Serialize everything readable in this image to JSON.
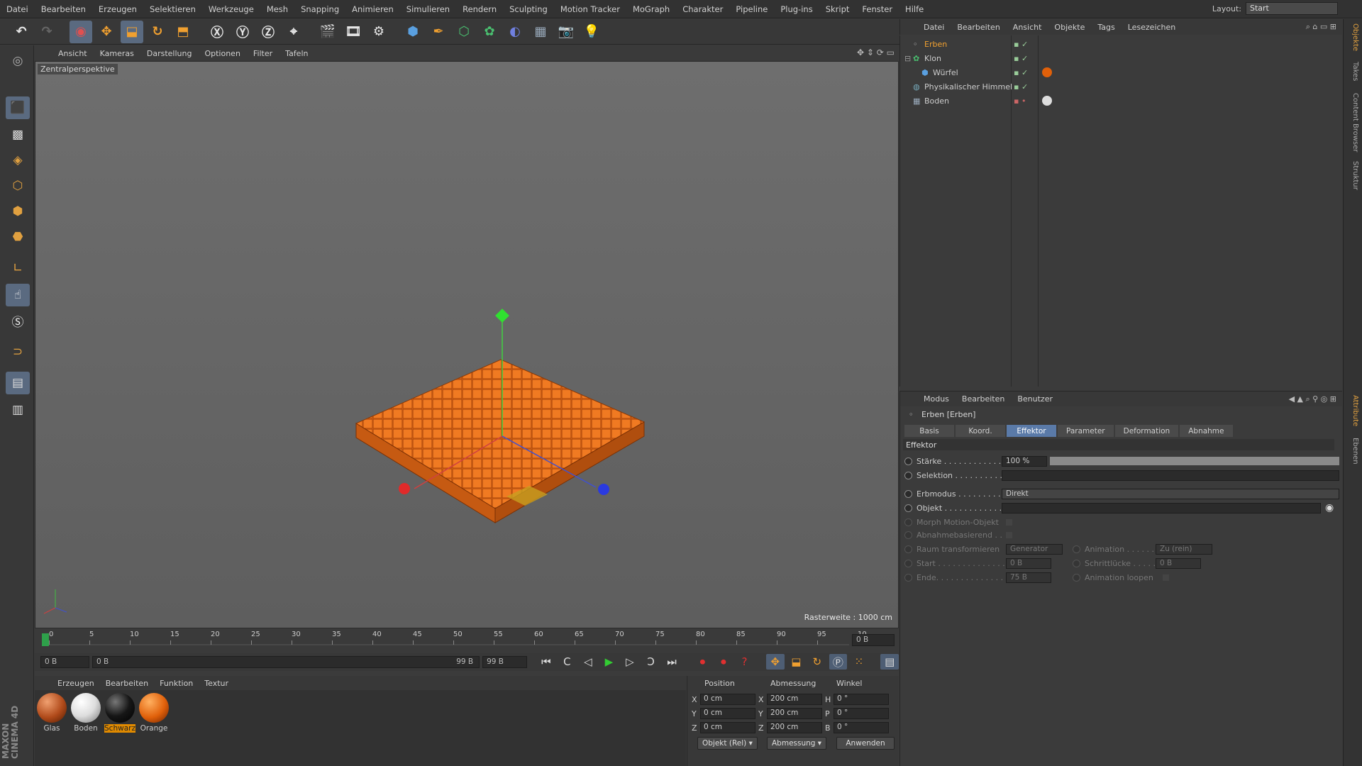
{
  "menubar": {
    "items": [
      "Datei",
      "Bearbeiten",
      "Erzeugen",
      "Selektieren",
      "Werkzeuge",
      "Mesh",
      "Snapping",
      "Animieren",
      "Simulieren",
      "Rendern",
      "Sculpting",
      "Motion Tracker",
      "MoGraph",
      "Charakter",
      "Pipeline",
      "Plug-ins",
      "Skript",
      "Fenster",
      "Hilfe"
    ],
    "layout_label": "Layout:",
    "layout_value": "Start"
  },
  "viewport": {
    "menu": [
      "Ansicht",
      "Kameras",
      "Darstellung",
      "Optionen",
      "Filter",
      "Tafeln"
    ],
    "label": "Zentralperspektive",
    "grid_label": "Rasterweite : 1000 cm"
  },
  "timeline": {
    "ticks": [
      "0",
      "5",
      "10",
      "15",
      "20",
      "25",
      "30",
      "35",
      "40",
      "45",
      "50",
      "55",
      "60",
      "65",
      "70",
      "75",
      "80",
      "85",
      "90",
      "95",
      "10"
    ],
    "end_field": "0 B",
    "start_frame": "0 B",
    "range_start": "0 B",
    "range_end": "99 B",
    "max_frame": "99 B"
  },
  "materials": {
    "menu": [
      "Erzeugen",
      "Bearbeiten",
      "Funktion",
      "Textur"
    ],
    "items": [
      {
        "name": "Glas",
        "color": "#b04a1a"
      },
      {
        "name": "Boden",
        "color": "#e8e8e8"
      },
      {
        "name": "Schwarz",
        "color": "#161616"
      },
      {
        "name": "Orange",
        "color": "#e0600a"
      }
    ]
  },
  "coords": {
    "headers": [
      "Position",
      "Abmessung",
      "Winkel"
    ],
    "rows": [
      {
        "axis": "X",
        "pos": "0 cm",
        "dim_axis": "X",
        "dim": "200 cm",
        "ang_axis": "H",
        "ang": "0 °"
      },
      {
        "axis": "Y",
        "pos": "0 cm",
        "dim_axis": "Y",
        "dim": "200 cm",
        "ang_axis": "P",
        "ang": "0 °"
      },
      {
        "axis": "Z",
        "pos": "0 cm",
        "dim_axis": "Z",
        "dim": "200 cm",
        "ang_axis": "B",
        "ang": "0 °"
      }
    ],
    "mode_dropdown": "Objekt (Rel)",
    "size_dropdown": "Abmessung",
    "apply": "Anwenden"
  },
  "objects": {
    "menu": [
      "Datei",
      "Bearbeiten",
      "Ansicht",
      "Objekte",
      "Tags",
      "Lesezeichen"
    ],
    "items": [
      {
        "name": "Erben",
        "indent": 0,
        "selected": true
      },
      {
        "name": "Klon",
        "indent": 0,
        "selected": false
      },
      {
        "name": "Würfel",
        "indent": 1,
        "selected": false
      },
      {
        "name": "Physikalischer Himmel",
        "indent": 0,
        "selected": false
      },
      {
        "name": "Boden",
        "indent": 0,
        "selected": false
      }
    ]
  },
  "attributes": {
    "menu": [
      "Modus",
      "Bearbeiten",
      "Benutzer"
    ],
    "title": "Erben [Erben]",
    "tabs": [
      "Basis",
      "Koord.",
      "Effektor",
      "Parameter",
      "Deformation",
      "Abnahme"
    ],
    "active_tab": 2,
    "section": "Effektor",
    "staerke_label": "Stärke . . . . . . . . . . . .",
    "staerke_value": "100 %",
    "selektion_label": "Selektion . . . . . . . . . .",
    "erbmodus_label": "Erbmodus . . . . . . . . .",
    "erbmodus_value": "Direkt",
    "objekt_label": "Objekt . . . . . . . . . . . .",
    "morph_label": "Morph Motion-Objekt",
    "abnahme_label": "Abnahmebasierend . .",
    "raum_label": "Raum transformieren",
    "raum_value": "Generator",
    "animation_label": "Animation . . . . . .",
    "animation_value": "Zu (rein)",
    "start_label": "Start . . . . . . . . . . . . . .",
    "start_value": "0 B",
    "schritt_label": "Schrittlücke . . . . .",
    "schritt_value": "0 B",
    "ende_label": "Ende. . . . . . . . . . . . . .",
    "ende_value": "75 B",
    "loop_label": "Animation loopen"
  },
  "right_strip": [
    "Objekte",
    "Takes",
    "Content Browser",
    "Struktur",
    "Attribute",
    "Ebenen"
  ]
}
